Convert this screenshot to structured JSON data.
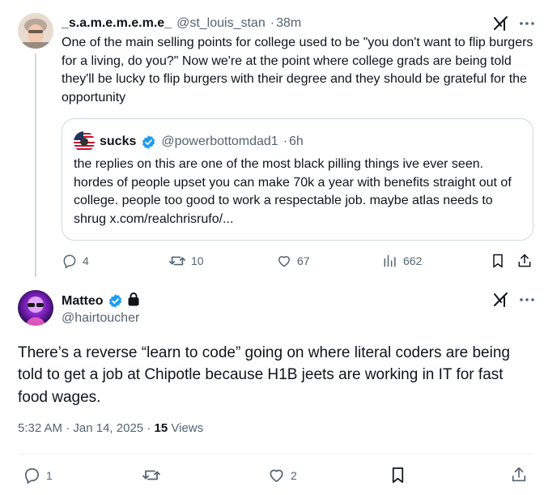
{
  "tweet1": {
    "display_name": "_s.a.m.e.m.e.m.e_",
    "handle": "@st_louis_stan",
    "separator": "·",
    "time": "38m",
    "text": "One of the main selling points for college used to be \"you don't want to flip burgers for a living, do you?\" Now we're at the point where college grads are being told they'll be lucky to flip burgers with their degree and they should be grateful for the opportunity",
    "quote": {
      "display_name": "sucks",
      "handle": "@powerbottomdad1",
      "separator": "·",
      "time": "6h",
      "text": "the replies on this are one of the most black pilling things ive ever seen. hordes of people upset you can make 70k a year with benefits straight out of college. people too good to work a respectable job. maybe atlas needs to shrug x.com/realchrisrufo/..."
    },
    "actions": {
      "replies": "4",
      "reposts": "10",
      "likes": "67",
      "views": "662"
    }
  },
  "tweet2": {
    "display_name": "Matteo",
    "handle": "@hairtoucher",
    "text": "There’s a reverse “learn to code” going on where literal coders are being told to get a job at Chipotle because H1B jeets are working in IT for fast food wages.",
    "time": "5:32 AM",
    "separator": "·",
    "date": "Jan 14, 2025",
    "views_count": "15",
    "views_label": "Views",
    "actions": {
      "replies": "1",
      "likes": "2"
    }
  },
  "colors": {
    "text": "#0f1419",
    "muted": "#536471",
    "verified": "#1d9bf0",
    "border": "#cfd9de"
  },
  "icons": [
    "grok-icon",
    "more-icon",
    "verified-badge-icon",
    "lock-icon",
    "reply-icon",
    "repost-icon",
    "like-icon",
    "views-icon",
    "bookmark-icon",
    "share-icon"
  ]
}
